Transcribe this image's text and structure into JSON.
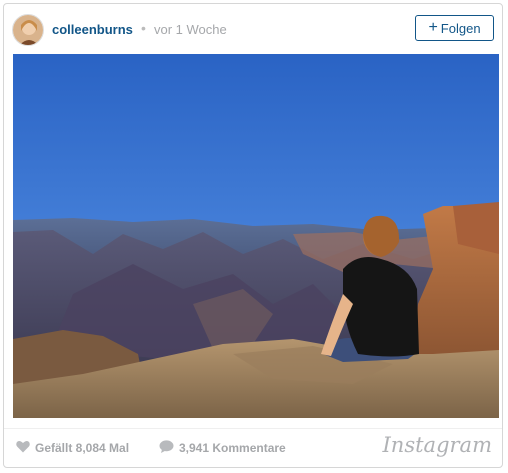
{
  "header": {
    "username": "colleenburns",
    "separator": "•",
    "timestamp": "vor 1 Woche",
    "follow_plus": "+",
    "follow_label": "Folgen"
  },
  "photo": {
    "icon": "landscape-photo"
  },
  "footer": {
    "likes_label": "Gefällt 8,084 Mal",
    "comments_label": "3,941 Kommentare",
    "logo_text": "Instagram"
  },
  "colors": {
    "accent": "#125688",
    "muted": "#a5a7aa",
    "border": "#d6d6d6"
  }
}
